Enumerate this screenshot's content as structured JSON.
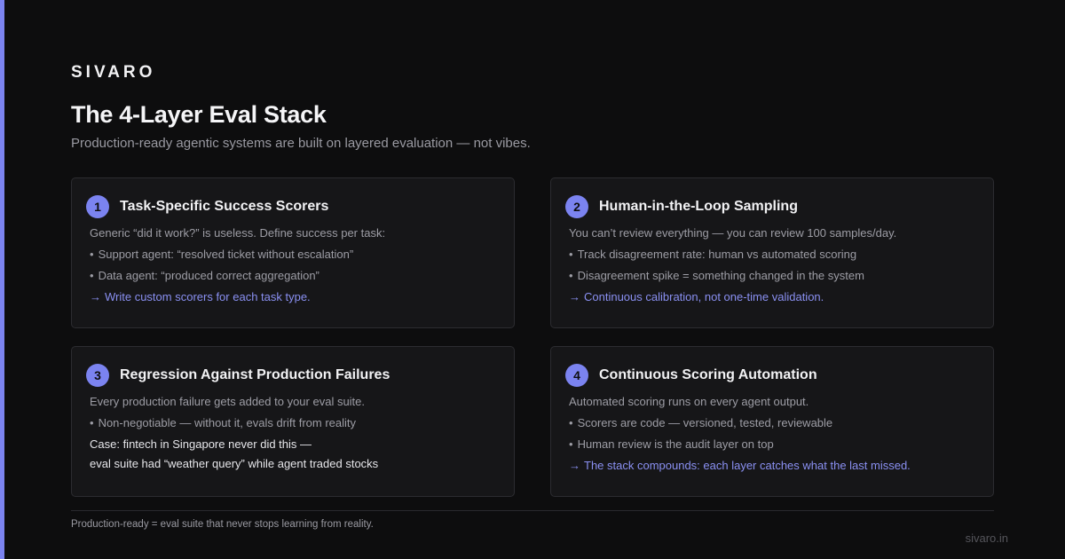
{
  "brand": "SIVARO",
  "title": "The 4-Layer Eval Stack",
  "subtitle": "Production-ready agentic systems are built on layered evaluation — not vibes.",
  "accent_color": "#7b83f0",
  "cards": [
    {
      "number": "1",
      "title": "Task-Specific Success Scorers",
      "intro": "Generic “did it work?” is useless. Define success per task:",
      "bullets": [
        "Support agent: “resolved ticket without escalation”",
        "Data agent: “produced correct aggregation”"
      ],
      "arrow": "→",
      "note": "Write custom scorers for each task type."
    },
    {
      "number": "2",
      "title": "Human-in-the-Loop Sampling",
      "intro": "You can’t review everything — you can review 100 samples/day.",
      "bullets": [
        "Track disagreement rate: human vs automated scoring",
        "Disagreement spike = something changed in the system"
      ],
      "arrow": "→",
      "note": "Continuous calibration, not one-time validation."
    },
    {
      "number": "3",
      "title": "Regression Against Production Failures",
      "intro": "Every production failure gets added to your eval suite.",
      "bullets": [
        "Non-negotiable — without it, evals drift from reality"
      ],
      "case_lines": [
        "Case: fintech in Singapore never did this —",
        "eval suite had “weather query” while agent traded stocks"
      ]
    },
    {
      "number": "4",
      "title": "Continuous Scoring Automation",
      "intro": "Automated scoring runs on every agent output.",
      "bullets": [
        "Scorers are code — versioned, tested, reviewable",
        "Human review is the audit layer on top"
      ],
      "arrow": "→",
      "note": "The stack compounds: each layer catches what the last missed."
    }
  ],
  "footer": {
    "note": "Production-ready = eval suite that never stops learning from reality.",
    "site": "sivaro.in"
  }
}
